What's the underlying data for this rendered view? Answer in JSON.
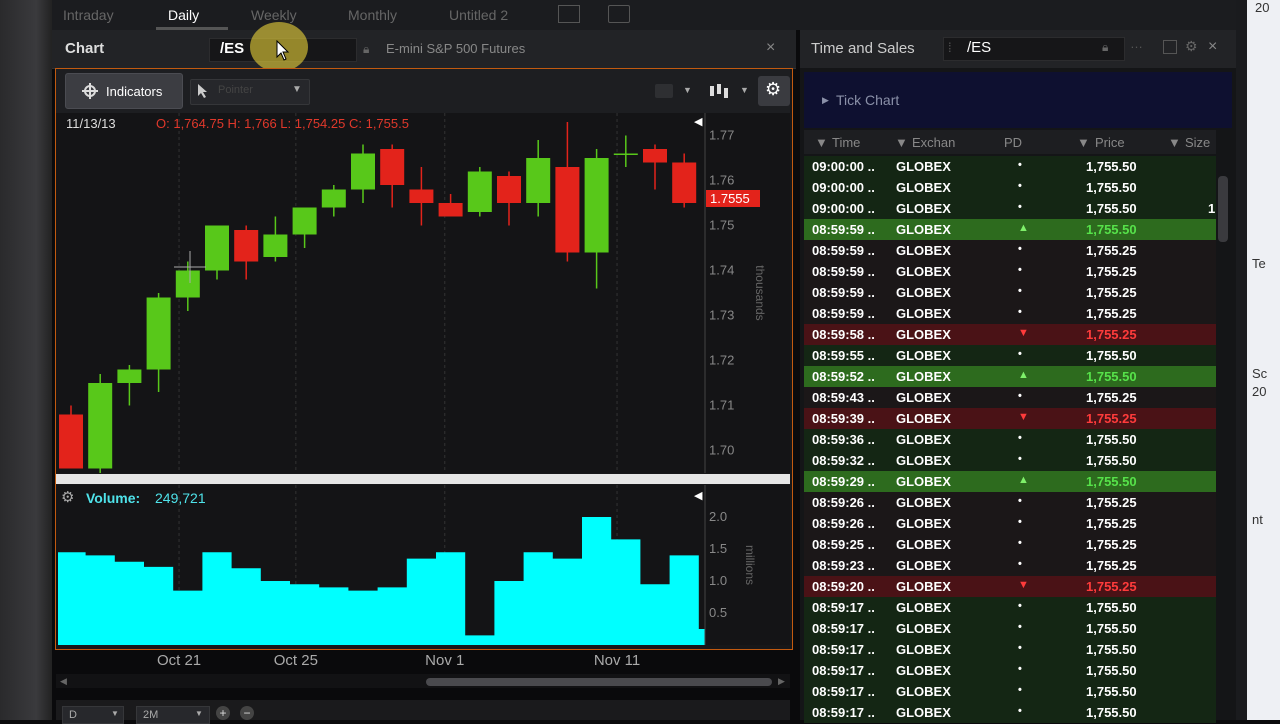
{
  "top_tabs": {
    "items": [
      {
        "label": "Intraday",
        "active": false
      },
      {
        "label": "Daily",
        "active": true
      },
      {
        "label": "Weekly",
        "active": false
      },
      {
        "label": "Monthly",
        "active": false
      },
      {
        "label": "Untitled 2",
        "active": false
      }
    ]
  },
  "chart_panel": {
    "title": "Chart",
    "symbol": "/ES",
    "description": "E-mini S&P 500 Futures",
    "close_icon": "×",
    "toolbar": {
      "indicators_label": "Indicators",
      "cursor_value": "Pointer"
    },
    "ohlc": {
      "date": "11/13/13",
      "values": "O: 1,764.75 H: 1,766 L: 1,754.25 C: 1,755.5"
    },
    "last_price_tag": "1.7555",
    "price_unit": "thousands",
    "volume_unit": "millions",
    "volume": {
      "label": "Volume:",
      "value": "249,721"
    },
    "bottom_controls": {
      "aggregation": "D",
      "span": "2M"
    },
    "colors": {
      "up": "#58c81a",
      "down": "#e3231b",
      "volume": "#00ffff",
      "accent": "#c25a10"
    }
  },
  "chart_data": {
    "type": "candlestick",
    "y_axis_price": {
      "ticks": [
        "1.77",
        "1.76",
        "1.75",
        "1.74",
        "1.73",
        "1.72",
        "1.71",
        "1.70"
      ],
      "ylim": [
        1.695,
        1.775
      ],
      "unit": "thousands"
    },
    "y_axis_volume": {
      "ticks": [
        "2.0",
        "1.5",
        "1.0",
        "0.5"
      ],
      "ylim": [
        0,
        2.5
      ],
      "unit": "millions"
    },
    "x_tick_labels": [
      {
        "label": "Oct 21",
        "index": 3.7
      },
      {
        "label": "Oct 25",
        "index": 7.7
      },
      {
        "label": "Nov 1",
        "index": 12.8
      },
      {
        "label": "Nov 11",
        "index": 18.7
      }
    ],
    "candles": [
      {
        "o": 1.708,
        "h": 1.71,
        "l": 1.696,
        "c": 1.696
      },
      {
        "o": 1.696,
        "h": 1.717,
        "l": 1.695,
        "c": 1.715
      },
      {
        "o": 1.715,
        "h": 1.719,
        "l": 1.71,
        "c": 1.718
      },
      {
        "o": 1.718,
        "h": 1.735,
        "l": 1.713,
        "c": 1.734
      },
      {
        "o": 1.734,
        "h": 1.742,
        "l": 1.731,
        "c": 1.74
      },
      {
        "o": 1.74,
        "h": 1.75,
        "l": 1.738,
        "c": 1.75
      },
      {
        "o": 1.749,
        "h": 1.75,
        "l": 1.738,
        "c": 1.742
      },
      {
        "o": 1.743,
        "h": 1.752,
        "l": 1.742,
        "c": 1.748
      },
      {
        "o": 1.748,
        "h": 1.754,
        "l": 1.745,
        "c": 1.754
      },
      {
        "o": 1.754,
        "h": 1.759,
        "l": 1.752,
        "c": 1.758
      },
      {
        "o": 1.758,
        "h": 1.768,
        "l": 1.755,
        "c": 1.766
      },
      {
        "o": 1.767,
        "h": 1.768,
        "l": 1.754,
        "c": 1.759
      },
      {
        "o": 1.758,
        "h": 1.763,
        "l": 1.75,
        "c": 1.755
      },
      {
        "o": 1.755,
        "h": 1.757,
        "l": 1.752,
        "c": 1.752
      },
      {
        "o": 1.753,
        "h": 1.763,
        "l": 1.752,
        "c": 1.762
      },
      {
        "o": 1.761,
        "h": 1.762,
        "l": 1.75,
        "c": 1.755
      },
      {
        "o": 1.755,
        "h": 1.769,
        "l": 1.752,
        "c": 1.765
      },
      {
        "o": 1.763,
        "h": 1.773,
        "l": 1.742,
        "c": 1.744
      },
      {
        "o": 1.744,
        "h": 1.767,
        "l": 1.736,
        "c": 1.765
      },
      {
        "o": 1.766,
        "h": 1.77,
        "l": 1.763,
        "c": 1.766
      },
      {
        "o": 1.767,
        "h": 1.768,
        "l": 1.758,
        "c": 1.764
      },
      {
        "o": 1.764,
        "h": 1.766,
        "l": 1.754,
        "c": 1.755
      }
    ],
    "volume_steps": [
      1.45,
      1.4,
      1.3,
      1.22,
      0.85,
      1.45,
      1.2,
      1.0,
      0.95,
      0.9,
      0.85,
      0.9,
      1.35,
      1.45,
      0.15,
      1.0,
      1.45,
      1.35,
      2.0,
      1.65,
      0.95,
      1.4,
      0.25
    ]
  },
  "time_and_sales": {
    "title": "Time and Sales",
    "symbol": "/ES",
    "close_icon": "×",
    "tick_chart_label": "Tick Chart",
    "columns": [
      "Time",
      "Exchan",
      "PD",
      "Price",
      "Size"
    ],
    "rows": [
      {
        "time": "09:00:00 ..",
        "ex": "GLOBEX",
        "pd": "•",
        "price": "1,755.50",
        "size": "",
        "type": "neutral"
      },
      {
        "time": "09:00:00 ..",
        "ex": "GLOBEX",
        "pd": "•",
        "price": "1,755.50",
        "size": "",
        "type": "neutral"
      },
      {
        "time": "09:00:00 ..",
        "ex": "GLOBEX",
        "pd": "•",
        "price": "1,755.50",
        "size": "1",
        "type": "neutral"
      },
      {
        "time": "08:59:59 ..",
        "ex": "GLOBEX",
        "pd": "▲",
        "price": "1,755.50",
        "size": "",
        "type": "up"
      },
      {
        "time": "08:59:59 ..",
        "ex": "GLOBEX",
        "pd": "•",
        "price": "1,755.25",
        "size": "",
        "type": "neutral-dn"
      },
      {
        "time": "08:59:59 ..",
        "ex": "GLOBEX",
        "pd": "•",
        "price": "1,755.25",
        "size": "",
        "type": "neutral-dn"
      },
      {
        "time": "08:59:59 ..",
        "ex": "GLOBEX",
        "pd": "•",
        "price": "1,755.25",
        "size": "",
        "type": "neutral-dn"
      },
      {
        "time": "08:59:59 ..",
        "ex": "GLOBEX",
        "pd": "•",
        "price": "1,755.25",
        "size": "",
        "type": "neutral-dn"
      },
      {
        "time": "08:59:58 ..",
        "ex": "GLOBEX",
        "pd": "▼",
        "price": "1,755.25",
        "size": "",
        "type": "down"
      },
      {
        "time": "08:59:55 ..",
        "ex": "GLOBEX",
        "pd": "•",
        "price": "1,755.50",
        "size": "",
        "type": "neutral"
      },
      {
        "time": "08:59:52 ..",
        "ex": "GLOBEX",
        "pd": "▲",
        "price": "1,755.50",
        "size": "",
        "type": "up"
      },
      {
        "time": "08:59:43 ..",
        "ex": "GLOBEX",
        "pd": "•",
        "price": "1,755.25",
        "size": "",
        "type": "neutral-dn"
      },
      {
        "time": "08:59:39 ..",
        "ex": "GLOBEX",
        "pd": "▼",
        "price": "1,755.25",
        "size": "",
        "type": "down"
      },
      {
        "time": "08:59:36 ..",
        "ex": "GLOBEX",
        "pd": "•",
        "price": "1,755.50",
        "size": "",
        "type": "neutral"
      },
      {
        "time": "08:59:32 ..",
        "ex": "GLOBEX",
        "pd": "•",
        "price": "1,755.50",
        "size": "",
        "type": "neutral"
      },
      {
        "time": "08:59:29 ..",
        "ex": "GLOBEX",
        "pd": "▲",
        "price": "1,755.50",
        "size": "",
        "type": "up"
      },
      {
        "time": "08:59:26 ..",
        "ex": "GLOBEX",
        "pd": "•",
        "price": "1,755.25",
        "size": "",
        "type": "neutral-dn"
      },
      {
        "time": "08:59:26 ..",
        "ex": "GLOBEX",
        "pd": "•",
        "price": "1,755.25",
        "size": "",
        "type": "neutral-dn"
      },
      {
        "time": "08:59:25 ..",
        "ex": "GLOBEX",
        "pd": "•",
        "price": "1,755.25",
        "size": "",
        "type": "neutral-dn"
      },
      {
        "time": "08:59:23 ..",
        "ex": "GLOBEX",
        "pd": "•",
        "price": "1,755.25",
        "size": "",
        "type": "neutral-dn"
      },
      {
        "time": "08:59:20 ..",
        "ex": "GLOBEX",
        "pd": "▼",
        "price": "1,755.25",
        "size": "",
        "type": "down"
      },
      {
        "time": "08:59:17 ..",
        "ex": "GLOBEX",
        "pd": "•",
        "price": "1,755.50",
        "size": "",
        "type": "neutral"
      },
      {
        "time": "08:59:17 ..",
        "ex": "GLOBEX",
        "pd": "•",
        "price": "1,755.50",
        "size": "",
        "type": "neutral"
      },
      {
        "time": "08:59:17 ..",
        "ex": "GLOBEX",
        "pd": "•",
        "price": "1,755.50",
        "size": "",
        "type": "neutral"
      },
      {
        "time": "08:59:17 ..",
        "ex": "GLOBEX",
        "pd": "•",
        "price": "1,755.50",
        "size": "",
        "type": "neutral"
      },
      {
        "time": "08:59:17 ..",
        "ex": "GLOBEX",
        "pd": "•",
        "price": "1,755.50",
        "size": "",
        "type": "neutral"
      },
      {
        "time": "08:59:17 ..",
        "ex": "GLOBEX",
        "pd": "•",
        "price": "1,755.50",
        "size": "",
        "type": "neutral"
      }
    ]
  },
  "edge_fragments": {
    "right_top": "20",
    "right_mid1": "Te",
    "right_mid2": "Sc",
    "right_mid3": "20",
    "right_low": "nt"
  }
}
